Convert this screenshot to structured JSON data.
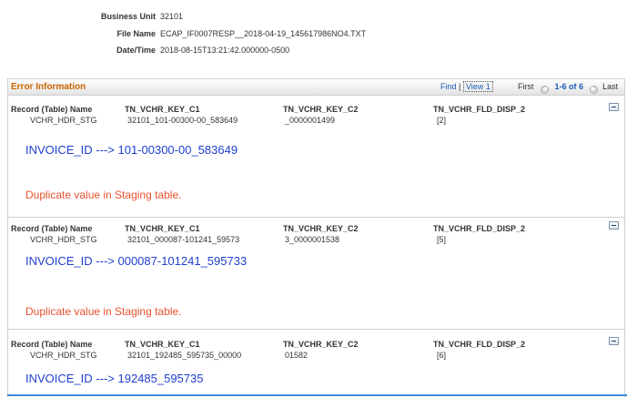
{
  "header": {
    "business_unit_label": "Business Unit",
    "business_unit_value": "32101",
    "file_name_label": "File Name",
    "file_name_value": "ECAP_IF0007RESP__2018-04-19_145617986NO4.TXT",
    "datetime_label": "Date/Time",
    "datetime_value": "2018-08-15T13:21:42.000000-0500"
  },
  "grid": {
    "title": "Error Information",
    "find": "Find",
    "sep": "|",
    "view": "View 1",
    "first": "First",
    "prev_icon": "◀",
    "count": "1-6 of 6",
    "next_icon": "▶",
    "last": "Last"
  },
  "columns": {
    "record": "Record (Table) Name",
    "key1": "TN_VCHR_KEY_C1",
    "key2": "TN_VCHR_KEY_C2",
    "fld": "TN_VCHR_FLD_DISP_2"
  },
  "rows": [
    {
      "record": "VCHR_HDR_STG",
      "key1": "32101_101-00300-00_583649",
      "key2": "_0000001499",
      "fld": "[2]",
      "invoice": "INVOICE_ID ---> 101-00300-00_583649",
      "message": "Duplicate value in Staging table."
    },
    {
      "record": "VCHR_HDR_STG",
      "key1": "32101_000087-101241_59573",
      "key2": "3_0000001538",
      "fld": "[5]",
      "invoice": "INVOICE_ID ---> 000087-101241_595733",
      "message": "Duplicate value in Staging table."
    },
    {
      "record": "VCHR_HDR_STG",
      "key1": "32101_192485_595735_00000",
      "key2": "01582",
      "fld": "[6]",
      "invoice": "INVOICE_ID ---> 192485_595735",
      "message": ""
    }
  ]
}
